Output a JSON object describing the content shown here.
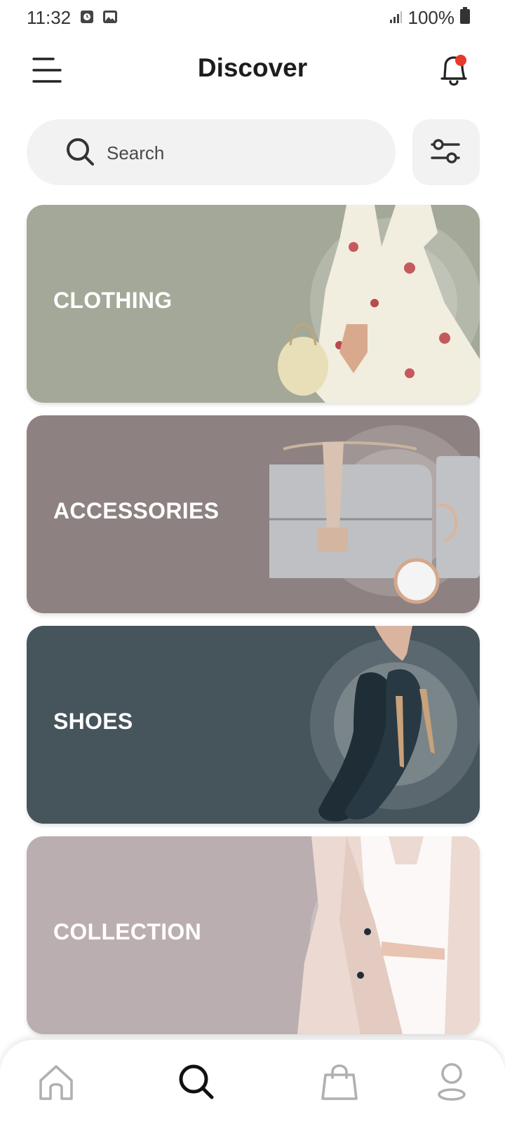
{
  "status_bar": {
    "time": "11:32",
    "battery": "100%",
    "icons": [
      "alarm-icon",
      "image-icon",
      "signal-icon",
      "battery-icon"
    ]
  },
  "header": {
    "title": "Discover",
    "menu_icon": "hamburger-menu-icon",
    "notification_icon": "bell-icon",
    "notification_badge_color": "#e8392b"
  },
  "search": {
    "placeholder": "Search",
    "value": "",
    "filter_icon": "sliders-icon"
  },
  "categories": [
    {
      "label": "CLOTHING",
      "color": "#a3a898",
      "image": "woman in floral wrap dress holding straw bag"
    },
    {
      "label": "ACCESSORIES",
      "color": "#8d8281",
      "image": "grey studded handbag with watch and bracelet"
    },
    {
      "label": "SHOES",
      "color": "#46545c",
      "image": "hand holding pair of navy high heels"
    },
    {
      "label": "COLLECTION",
      "color": "#bbaeb1",
      "image": "woman in pink blazer and white top"
    }
  ],
  "bottom_nav": {
    "items": [
      {
        "name": "home",
        "icon": "home-icon",
        "active": false
      },
      {
        "name": "search",
        "icon": "search-icon",
        "active": true
      },
      {
        "name": "shop",
        "icon": "shopping-bag-icon",
        "active": false
      },
      {
        "name": "profile",
        "icon": "user-icon",
        "active": false
      }
    ],
    "active_color": "#111111",
    "inactive_color": "#b0b0b0"
  }
}
